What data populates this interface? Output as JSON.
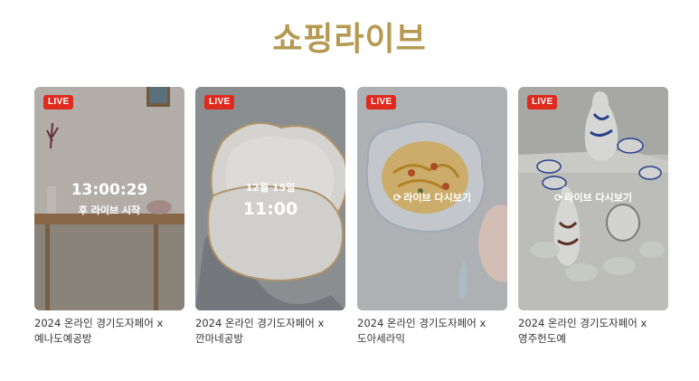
{
  "section": {
    "title": "쇼핑라이브"
  },
  "cards": [
    {
      "badge": "LIVE",
      "overlay_type": "countdown",
      "time": "13:00:29",
      "subtitle": "후 라이브 시작",
      "caption_line1": "2024 온라인 경기도자페어 x",
      "caption_line2": "예나도예공방"
    },
    {
      "badge": "LIVE",
      "overlay_type": "schedule",
      "date": "12월 15일",
      "time": "11:00",
      "caption_line1": "2024 온라인 경기도자페어 x",
      "caption_line2": "깐마네공방"
    },
    {
      "badge": "LIVE",
      "overlay_type": "replay",
      "replay_label": "라이브 다시보기",
      "caption_line1": "2024 온라인 경기도자페어 x",
      "caption_line2": "도아세라믹"
    },
    {
      "badge": "LIVE",
      "overlay_type": "replay",
      "replay_label": "라이브 다시보기",
      "caption_line1": "2024 온라인 경기도자페어 x",
      "caption_line2": "영주헌도예"
    }
  ],
  "colors": {
    "title": "#b69a52",
    "live_badge": "#e02a1e"
  },
  "icons": {
    "replay": "refresh-icon"
  }
}
